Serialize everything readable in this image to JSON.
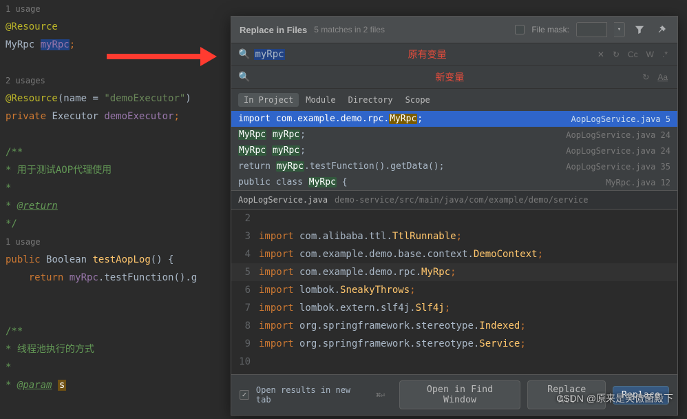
{
  "editor": {
    "usages1": "1 usage",
    "anno1": "@Resource",
    "line_myrpc_type": "MyRpc",
    "line_myrpc_field": "myRpc",
    "usages2": "2 usages",
    "anno2_pre": "@Resource",
    "anno2_name_key": "name = ",
    "anno2_val": "\"demoExecutor\"",
    "priv": "private",
    "exec_type": "Executor",
    "exec_field": "demoExecutor",
    "doc_open": "/**",
    "doc_star": " *",
    "doc_line1": " * 用于测试AOP代理使用",
    "doc_return_pre": " * ",
    "doc_return": "@return",
    "doc_close": " */",
    "usages3": "1 usage",
    "pub": "public",
    "bool": "Boolean",
    "method": "testAopLog",
    "ret": "return",
    "ret_field": "myRpc",
    "ret_rest": ".testFunction().g",
    "doc2_line1": " * 线程池执行的方式",
    "doc_param_pre": " * ",
    "doc_param": "@param",
    "doc_param_s": "s"
  },
  "dialog": {
    "title": "Replace in Files",
    "subtitle": "5 matches in 2 files",
    "filemask_label": "File mask:",
    "search_value": "myRpc",
    "anno_search": "原有变量",
    "anno_replace": "新变量",
    "opts": {
      "cc": "Cc",
      "w": "W",
      "star": ".*"
    },
    "scopes": [
      "In Project",
      "Module",
      "Directory",
      "Scope"
    ],
    "results": [
      {
        "pre": "import com.example.demo.rpc.",
        "match": "MyRpc",
        "post": ";",
        "file": "AopLogService.java",
        "ln": "5",
        "sel": true
      },
      {
        "pre": "",
        "match": "MyRpc",
        "post": " ",
        "match2": "myRpc",
        "post2": ";",
        "file": "AopLogService.java",
        "ln": "24"
      },
      {
        "pre": "",
        "match": "MyRpc",
        "post": " ",
        "match2": "myRpc",
        "post2": ";",
        "file": "AopLogService.java",
        "ln": "24"
      },
      {
        "pre": "return ",
        "match": "myRpc",
        "post": ".testFunction().getData();",
        "file": "AopLogService.java",
        "ln": "35"
      },
      {
        "pre": "public class ",
        "match": "MyRpc",
        "post": " {",
        "file": "MyRpc.java",
        "ln": "12"
      }
    ],
    "preview_file": "AopLogService.java",
    "preview_path": "demo-service/src/main/java/com/example/demo/service",
    "preview": [
      {
        "n": "2",
        "code": ""
      },
      {
        "n": "3",
        "kw": "import",
        "rest": " com.alibaba.ttl.",
        "id": "TtlRunnable",
        "end": ";"
      },
      {
        "n": "4",
        "kw": "import",
        "rest": " com.example.demo.base.context.",
        "id": "DemoContext",
        "end": ";"
      },
      {
        "n": "5",
        "kw": "import",
        "rest": " com.example.demo.rpc.",
        "id": "MyRpc",
        "end": ";",
        "cur": true
      },
      {
        "n": "6",
        "kw": "import",
        "rest": " lombok.",
        "id": "SneakyThrows",
        "end": ";"
      },
      {
        "n": "7",
        "kw": "import",
        "rest": " lombok.extern.slf4j.",
        "id": "Slf4j",
        "end": ";"
      },
      {
        "n": "8",
        "kw": "import",
        "rest": " org.springframework.stereotype.",
        "id": "Indexed",
        "end": ";"
      },
      {
        "n": "9",
        "kw": "import",
        "rest": " org.springframework.stereotype.",
        "id": "Service",
        "end": ";"
      },
      {
        "n": "10",
        "code": ""
      }
    ],
    "footer": {
      "newtab": "Open results in new tab",
      "kbd": "⌘⏎",
      "open_find": "Open in Find Window",
      "replace_all": "Replace All",
      "replace": "Replace"
    }
  },
  "watermark": "CSDN @原来是笑傲菌殿下"
}
